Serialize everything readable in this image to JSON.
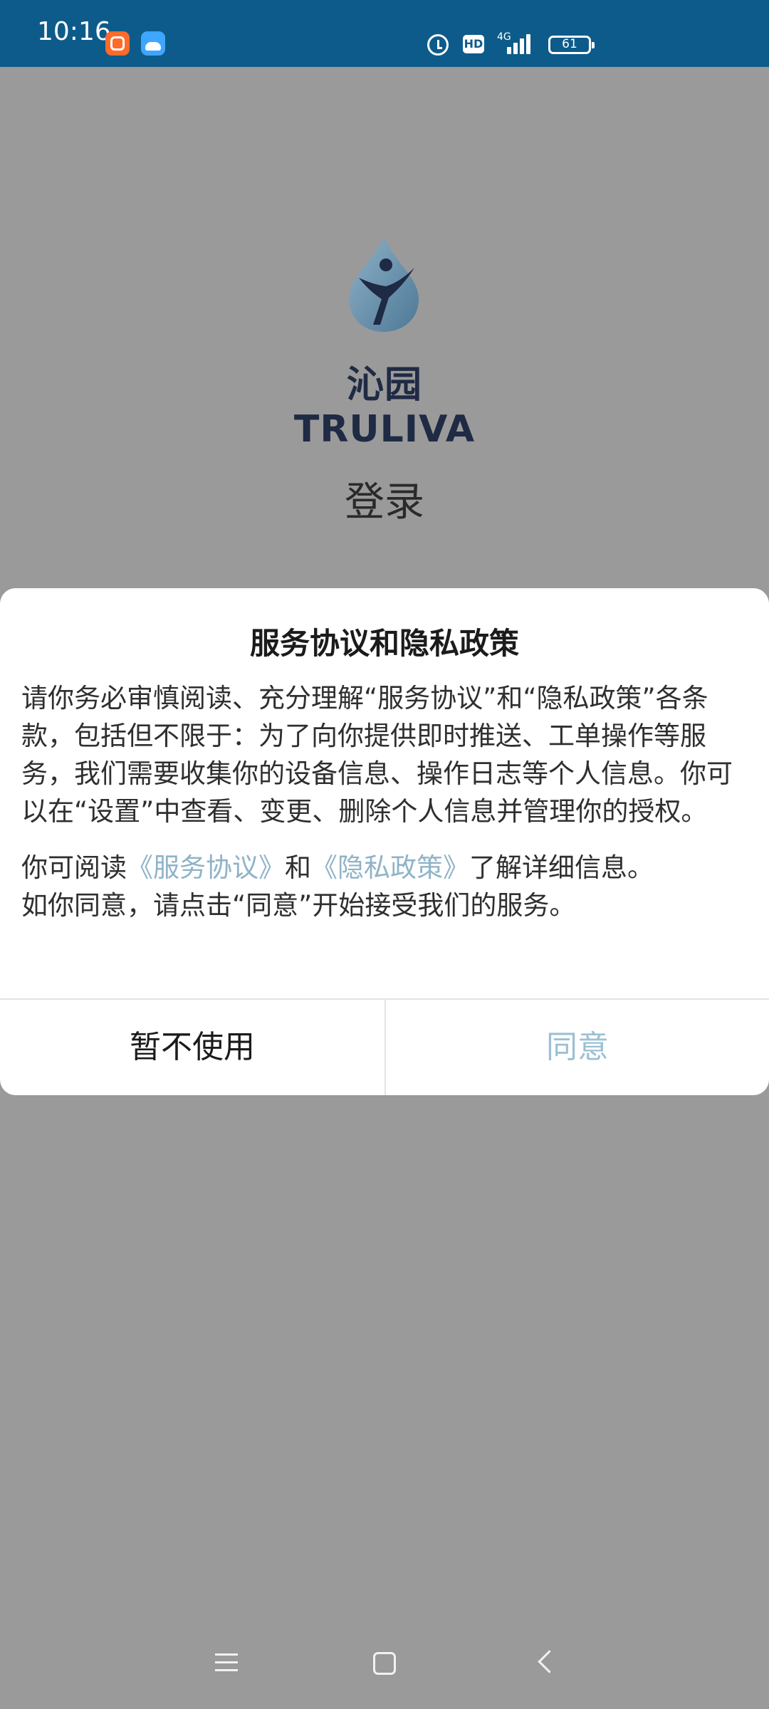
{
  "status_bar": {
    "time": "10:16",
    "network": "4G",
    "hd": "HD",
    "battery": "61"
  },
  "app": {
    "brand": "沁园TRULIVA",
    "page_title": "登录"
  },
  "dialog": {
    "title": "服务协议和隐私政策",
    "paragraph1": "请你务必审慎阅读、充分理解“服务协议”和“隐私政策”各条款，包括但不限于：为了向你提供即时推送、工单操作等服务，我们需要收集你的设备信息、操作日志等个人信息。你可以在“设置”中查看、变更、删除个人信息并管理你的授权。",
    "p2_prefix": "你可阅读",
    "service_link": "《服务协议》",
    "p2_and": "和",
    "privacy_link": "《隐私政策》",
    "p2_suffix": "了解详细信息。",
    "p3": "如你同意，请点击“同意”开始接受我们的服务。",
    "cancel_label": "暂不使用",
    "agree_label": "同意"
  },
  "colors": {
    "status_bar_bg": "#0d5b8a",
    "overlay_bg": "#9a9a9a",
    "link": "#8fb3c7",
    "agree_button": "#9cc0d3"
  },
  "icons": {
    "nav_menu": "menu-icon",
    "nav_home": "home-icon",
    "nav_back": "back-icon",
    "alarm": "alarm-icon",
    "signal": "signal-icon",
    "battery": "battery-icon"
  }
}
